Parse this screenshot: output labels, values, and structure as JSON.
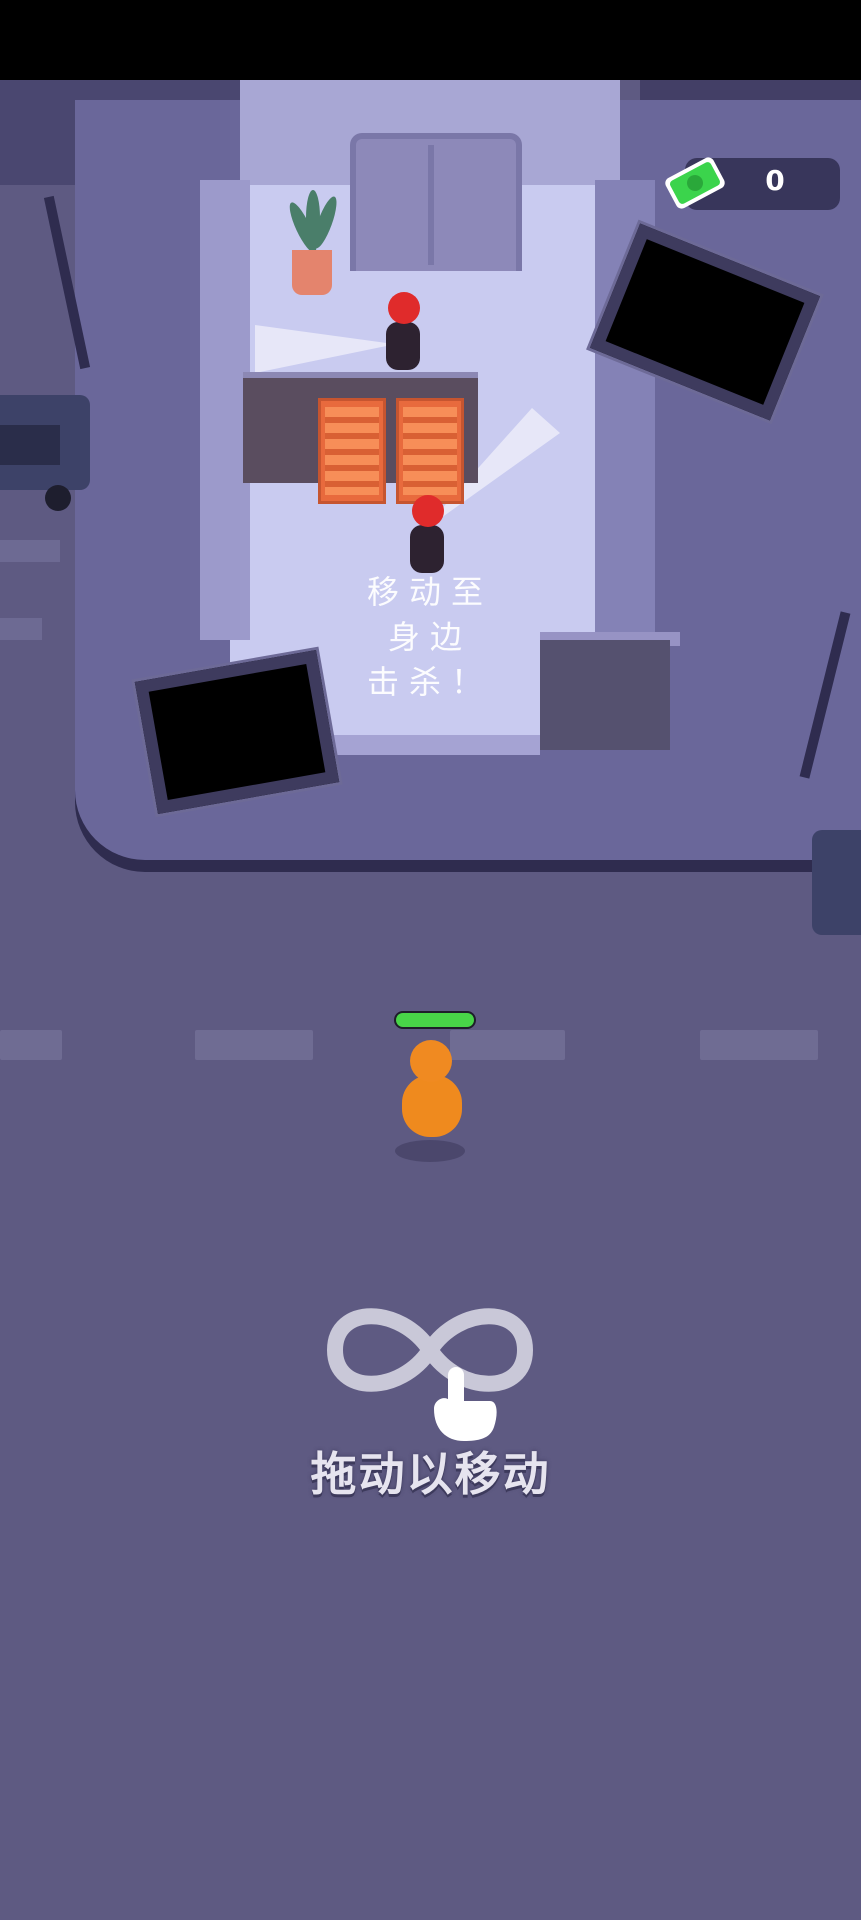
{
  "hud": {
    "cash_value": "0",
    "player_health": 1.0
  },
  "level_hint": {
    "line1": "移动至",
    "line2": "身边",
    "line3": "击杀！"
  },
  "tutorial": {
    "drag_label": "拖动以移动"
  },
  "colors": {
    "background": "#5e5a82",
    "player": "#ef8a1e",
    "enemy_head": "#e02b2b",
    "health_fill": "#48d448",
    "cash": "#3bd44c"
  },
  "icons": [
    "cash-icon",
    "infinity-gesture-icon",
    "pointing-hand-icon"
  ]
}
